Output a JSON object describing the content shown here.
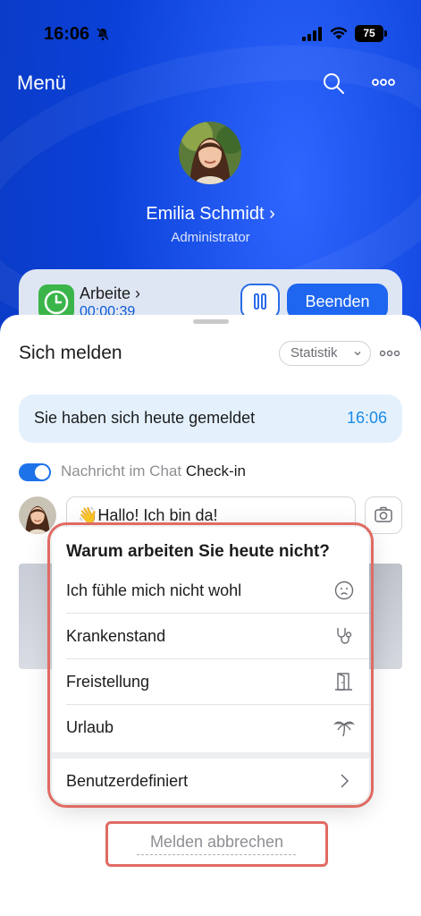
{
  "status_bar": {
    "time": "16:06",
    "battery": "75"
  },
  "header": {
    "title": "Menü"
  },
  "profile": {
    "name": "Emilia Schmidt",
    "role": "Administrator"
  },
  "work_card": {
    "label": "Arbeite",
    "timer": "00:00:39",
    "end_label": "Beenden"
  },
  "sheet": {
    "title": "Sich melden",
    "stats_label": "Statistik",
    "banner_text": "Sie haben sich heute gemeldet",
    "banner_time": "16:06",
    "chat_toggle_label": "Nachricht im Chat",
    "chat_toggle_label_strong": "Check-in",
    "message_value": "👋Hallo! Ich bin da!"
  },
  "popover": {
    "title": "Warum arbeiten Sie heute nicht?",
    "items": [
      {
        "label": "Ich fühle mich nicht wohl",
        "icon": "sad-face-icon"
      },
      {
        "label": "Krankenstand",
        "icon": "stethoscope-icon"
      },
      {
        "label": "Freistellung",
        "icon": "door-icon"
      },
      {
        "label": "Urlaub",
        "icon": "palm-tree-icon"
      }
    ],
    "custom_label": "Benutzerdefiniert"
  },
  "cancel": {
    "label": "Melden abbrechen"
  },
  "colors": {
    "accent": "#1e66f0",
    "highlight": "#e06b63",
    "banner": "#e4f1fd"
  }
}
